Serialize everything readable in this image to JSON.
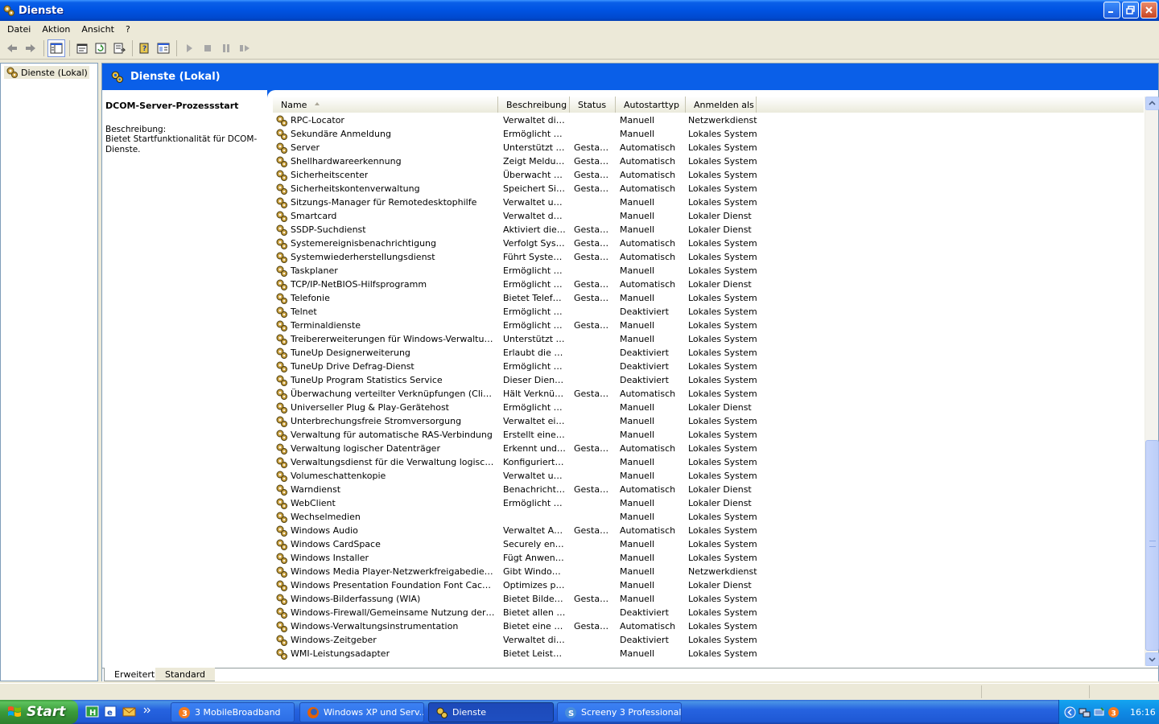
{
  "window": {
    "title": "Dienste"
  },
  "menu": [
    "Datei",
    "Aktion",
    "Ansicht",
    "?"
  ],
  "tree": {
    "root_label": "Dienste (Lokal)"
  },
  "banner": {
    "title": "Dienste (Lokal)"
  },
  "description": {
    "service_title": "DCOM-Server-Prozessstart",
    "label": "Beschreibung:",
    "text": "Bietet Startfunktionalität für DCOM-Dienste."
  },
  "columns": [
    {
      "label": "Name",
      "width": 280
    },
    {
      "label": "Beschreibung",
      "width": 89
    },
    {
      "label": "Status",
      "width": 57
    },
    {
      "label": "Autostarttyp",
      "width": 87
    },
    {
      "label": "Anmelden als",
      "width": 88
    }
  ],
  "rows": [
    [
      "RPC-Locator",
      "Verwaltet die...",
      "",
      "Manuell",
      "Netzwerkdienst"
    ],
    [
      "Sekundäre Anmeldung",
      "Ermöglicht da...",
      "",
      "Manuell",
      "Lokales System"
    ],
    [
      "Server",
      "Unterstützt D...",
      "Gestar...",
      "Automatisch",
      "Lokales System"
    ],
    [
      "Shellhardwareerkennung",
      "Zeigt Meldun...",
      "Gestar...",
      "Automatisch",
      "Lokales System"
    ],
    [
      "Sicherheitscenter",
      "Überwacht S...",
      "Gestar...",
      "Automatisch",
      "Lokales System"
    ],
    [
      "Sicherheitskontenverwaltung",
      "Speichert Sic...",
      "Gestar...",
      "Automatisch",
      "Lokales System"
    ],
    [
      "Sitzungs-Manager für Remotedesktophilfe",
      "Verwaltet un...",
      "",
      "Manuell",
      "Lokales System"
    ],
    [
      "Smartcard",
      "Verwaltet de...",
      "",
      "Manuell",
      "Lokaler Dienst"
    ],
    [
      "SSDP-Suchdienst",
      "Aktiviert die ...",
      "Gestar...",
      "Manuell",
      "Lokaler Dienst"
    ],
    [
      "Systemereignisbenachrichtigung",
      "Verfolgt Syst...",
      "Gestar...",
      "Automatisch",
      "Lokales System"
    ],
    [
      "Systemwiederherstellungsdienst",
      "Führt System...",
      "Gestar...",
      "Automatisch",
      "Lokales System"
    ],
    [
      "Taskplaner",
      "Ermöglicht ei...",
      "",
      "Manuell",
      "Lokales System"
    ],
    [
      "TCP/IP-NetBIOS-Hilfsprogramm",
      "Ermöglicht di...",
      "Gestar...",
      "Automatisch",
      "Lokaler Dienst"
    ],
    [
      "Telefonie",
      "Bietet Telefo...",
      "Gestar...",
      "Manuell",
      "Lokales System"
    ],
    [
      "Telnet",
      "Ermöglicht ei...",
      "",
      "Deaktiviert",
      "Lokales System"
    ],
    [
      "Terminaldienste",
      "Ermöglicht m...",
      "Gestar...",
      "Manuell",
      "Lokales System"
    ],
    [
      "Treibererweiterungen für Windows-Verwaltungsins...",
      "Unterstützt S...",
      "",
      "Manuell",
      "Lokales System"
    ],
    [
      "TuneUp Designerweiterung",
      "Erlaubt die V...",
      "",
      "Deaktiviert",
      "Lokales System"
    ],
    [
      "TuneUp Drive Defrag-Dienst",
      "Ermöglicht Tu...",
      "",
      "Deaktiviert",
      "Lokales System"
    ],
    [
      "TuneUp Program Statistics Service",
      "Dieser Dienst...",
      "",
      "Deaktiviert",
      "Lokales System"
    ],
    [
      "Überwachung verteilter Verknüpfungen (Client)",
      "Hält Verknüpf...",
      "Gestar...",
      "Automatisch",
      "Lokales System"
    ],
    [
      "Universeller Plug & Play-Gerätehost",
      "Ermöglicht es...",
      "",
      "Manuell",
      "Lokaler Dienst"
    ],
    [
      "Unterbrechungsfreie Stromversorgung",
      "Verwaltet ein...",
      "",
      "Manuell",
      "Lokales System"
    ],
    [
      "Verwaltung für automatische RAS-Verbindung",
      "Erstellt eine V...",
      "",
      "Manuell",
      "Lokales System"
    ],
    [
      "Verwaltung logischer Datenträger",
      "Erkennt und ...",
      "Gestar...",
      "Automatisch",
      "Lokales System"
    ],
    [
      "Verwaltungsdienst für die Verwaltung logischer Dat...",
      "Konfiguriert F...",
      "",
      "Manuell",
      "Lokales System"
    ],
    [
      "Volumeschattenkopie",
      "Verwaltet un...",
      "",
      "Manuell",
      "Lokales System"
    ],
    [
      "Warndienst",
      "Benachrichtig...",
      "Gestar...",
      "Automatisch",
      "Lokaler Dienst"
    ],
    [
      "WebClient",
      "Ermöglicht Wi...",
      "",
      "Manuell",
      "Lokaler Dienst"
    ],
    [
      "Wechselmedien",
      "",
      "",
      "Manuell",
      "Lokales System"
    ],
    [
      "Windows Audio",
      "Verwaltet Au...",
      "Gestar...",
      "Automatisch",
      "Lokales System"
    ],
    [
      "Windows CardSpace",
      "Securely ena...",
      "",
      "Manuell",
      "Lokales System"
    ],
    [
      "Windows Installer",
      "Fügt Anwend...",
      "",
      "Manuell",
      "Lokales System"
    ],
    [
      "Windows Media Player-Netzwerkfreigabedienst",
      "Gibt Windows...",
      "",
      "Manuell",
      "Netzwerkdienst"
    ],
    [
      "Windows Presentation Foundation Font Cache 3.0....",
      "Optimizes per...",
      "",
      "Manuell",
      "Lokaler Dienst"
    ],
    [
      "Windows-Bilderfassung (WIA)",
      "Bietet Bilderf...",
      "Gestar...",
      "Manuell",
      "Lokales System"
    ],
    [
      "Windows-Firewall/Gemeinsame Nutzung der Intern...",
      "Bietet allen C...",
      "",
      "Deaktiviert",
      "Lokales System"
    ],
    [
      "Windows-Verwaltungsinstrumentation",
      "Bietet eine st...",
      "Gestar...",
      "Automatisch",
      "Lokales System"
    ],
    [
      "Windows-Zeitgeber",
      "Verwaltet die...",
      "",
      "Deaktiviert",
      "Lokales System"
    ],
    [
      "WMI-Leistungsadapter",
      "Bietet Leistun...",
      "",
      "Manuell",
      "Lokales System"
    ]
  ],
  "tabs": {
    "extended": "Erweitert",
    "standard": "Standard"
  },
  "taskbar": {
    "start_label": "Start",
    "tasks": [
      {
        "label": "3 MobileBroadband",
        "icon": "mobilebroadband-icon"
      },
      {
        "label": "Windows XP und Serv...",
        "icon": "firefox-icon"
      },
      {
        "label": "Dienste",
        "icon": "services-gear-icon"
      },
      {
        "label": "Screeny 3 Professional",
        "icon": "screeny-icon"
      }
    ],
    "clock": "16:16"
  },
  "colors": {
    "title_blue": "#0054E3",
    "banner_blue": "#0A5FE8",
    "start_green": "#3A9A3A",
    "window_face": "#ECE9D8"
  }
}
